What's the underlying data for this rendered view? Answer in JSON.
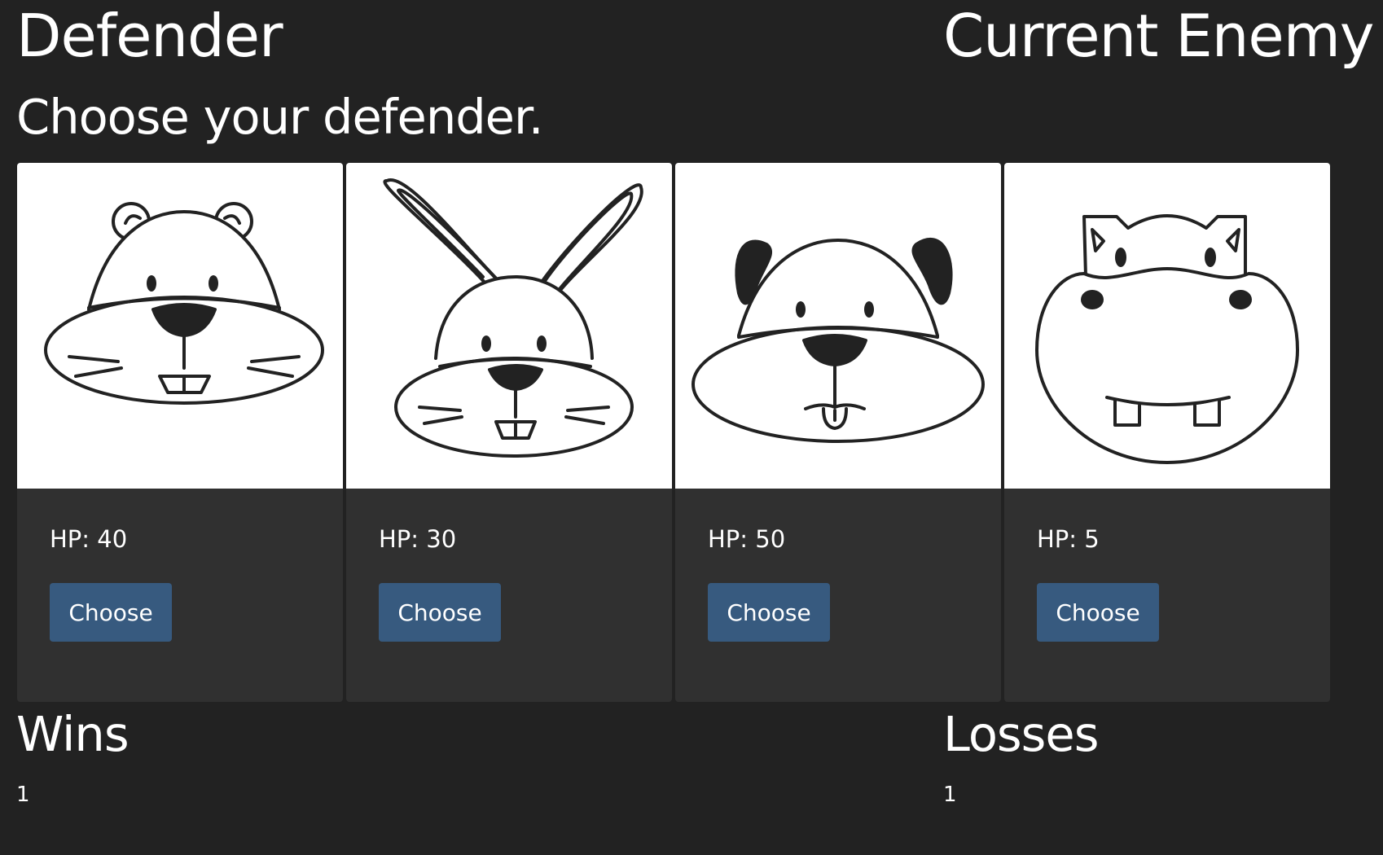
{
  "header": {
    "defender_title": "Defender",
    "enemy_title": "Current Enemy",
    "instruction": "Choose your defender."
  },
  "characters": [
    {
      "animal": "beaver-icon",
      "hp_label": "HP:",
      "hp": "40",
      "button_label": "Choose"
    },
    {
      "animal": "rabbit-icon",
      "hp_label": "HP:",
      "hp": "30",
      "button_label": "Choose"
    },
    {
      "animal": "dog-icon",
      "hp_label": "HP:",
      "hp": "50",
      "button_label": "Choose"
    },
    {
      "animal": "hippo-icon",
      "hp_label": "HP:",
      "hp": "5",
      "button_label": "Choose"
    }
  ],
  "stats": {
    "wins_label": "Wins",
    "wins_value": "1",
    "losses_label": "Losses",
    "losses_value": "1"
  },
  "colors": {
    "background": "#222222",
    "card": "#303030",
    "button": "#375a7f",
    "text": "#ffffff"
  }
}
